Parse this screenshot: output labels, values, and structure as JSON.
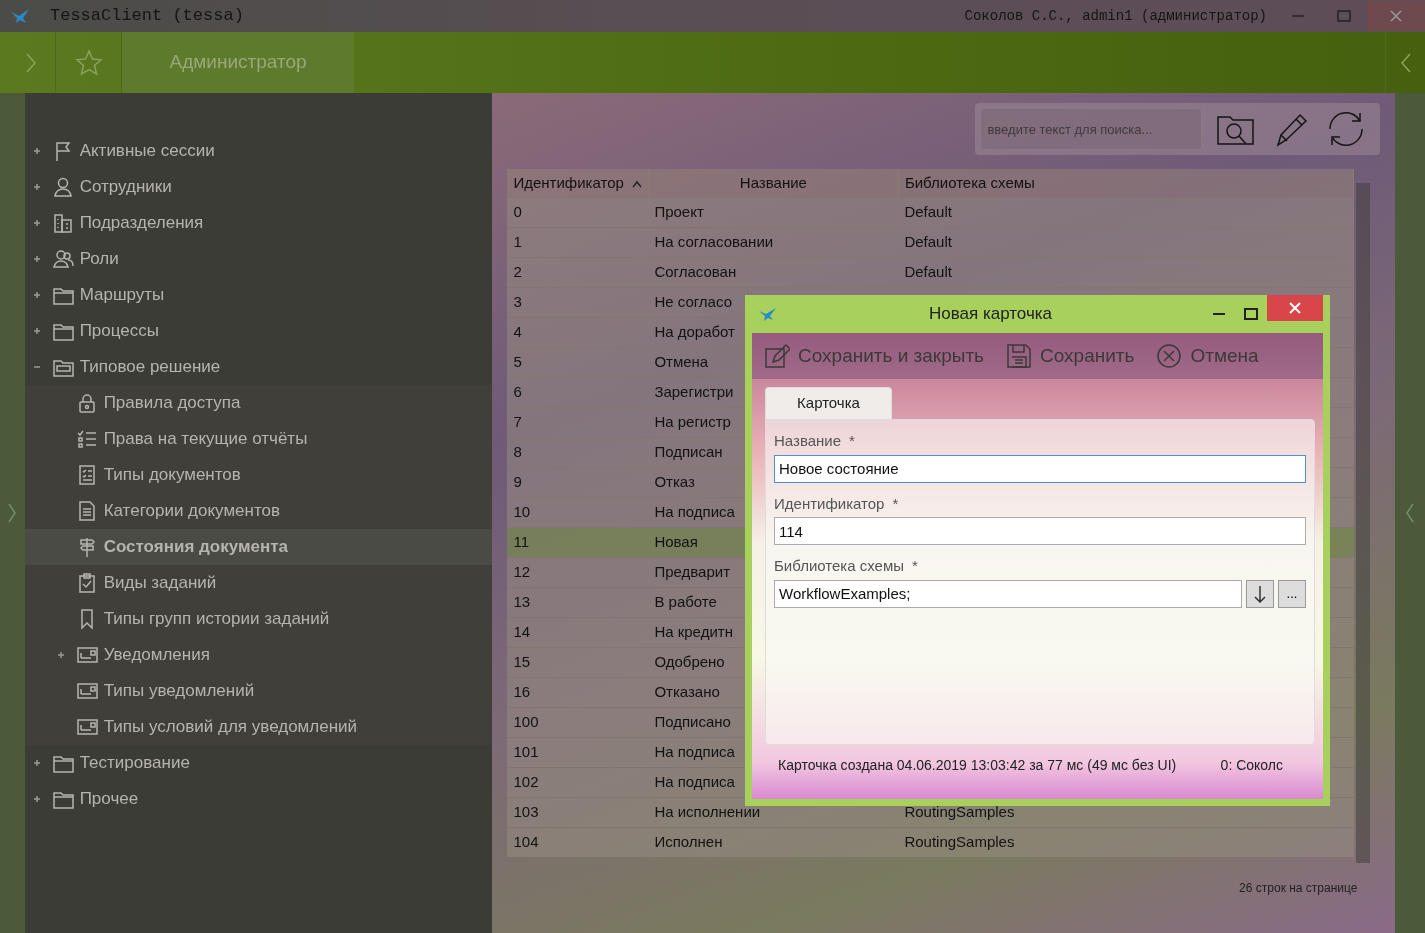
{
  "window": {
    "title": "TessaClient (tessa)",
    "user": "Соколов С.С., admin1 (администратор)"
  },
  "toolbar": {
    "tabs": [
      {
        "label": "Администратор",
        "selected": true
      }
    ]
  },
  "sidebar": {
    "items": [
      {
        "label": "Активные сессии",
        "expanded": false,
        "selected": false
      },
      {
        "label": "Сотрудники",
        "expanded": false,
        "selected": false
      },
      {
        "label": "Подразделения",
        "expanded": false,
        "selected": false
      },
      {
        "label": "Роли",
        "expanded": false,
        "selected": false
      },
      {
        "label": "Маршруты",
        "expanded": false,
        "selected": false
      },
      {
        "label": "Процессы",
        "expanded": false,
        "selected": false
      },
      {
        "label": "Типовое решение",
        "expanded": true,
        "selected": false,
        "children": [
          {
            "label": "Правила доступа",
            "selected": false
          },
          {
            "label": "Права на текущие отчёты",
            "selected": false
          },
          {
            "label": "Типы документов",
            "selected": false
          },
          {
            "label": "Категории документов",
            "selected": false
          },
          {
            "label": "Состояния документа",
            "selected": true
          },
          {
            "label": "Виды заданий",
            "selected": false
          },
          {
            "label": "Типы групп истории заданий",
            "selected": false
          },
          {
            "label": "Уведомления",
            "expanded": false,
            "selected": false
          },
          {
            "label": "Типы уведомлений",
            "selected": false
          },
          {
            "label": "Типы условий для уведомлений",
            "selected": false
          }
        ]
      },
      {
        "label": "Тестирование",
        "expanded": false,
        "selected": false
      },
      {
        "label": "Прочее",
        "expanded": false,
        "selected": false
      }
    ]
  },
  "search": {
    "placeholder": "введите текст для поиска..."
  },
  "table": {
    "columns": [
      {
        "label": "Идентификатор",
        "sorted": true
      },
      {
        "label": "Название",
        "sorted": false
      },
      {
        "label": "Библиотека схемы",
        "sorted": false
      }
    ],
    "rows": [
      {
        "id": "0",
        "name": "Проект",
        "library": "Default",
        "selected": false
      },
      {
        "id": "1",
        "name": "На согласовании",
        "library": "Default",
        "selected": false
      },
      {
        "id": "2",
        "name": "Согласован",
        "library": "Default",
        "selected": false
      },
      {
        "id": "3",
        "name": "Не согласо",
        "selected": false
      },
      {
        "id": "4",
        "name": "На доработ",
        "selected": false
      },
      {
        "id": "5",
        "name": "Отмена",
        "selected": false
      },
      {
        "id": "6",
        "name": "Зарегистри",
        "selected": false
      },
      {
        "id": "7",
        "name": "На регистр",
        "selected": false
      },
      {
        "id": "8",
        "name": "Подписан",
        "selected": false
      },
      {
        "id": "9",
        "name": "Отказ",
        "selected": false
      },
      {
        "id": "10",
        "name": "На подписа",
        "selected": false
      },
      {
        "id": "11",
        "name": "Новая",
        "selected": true
      },
      {
        "id": "12",
        "name": "Предварит",
        "selected": false
      },
      {
        "id": "13",
        "name": "В работе",
        "selected": false
      },
      {
        "id": "14",
        "name": "На кредитн",
        "selected": false
      },
      {
        "id": "15",
        "name": "Одобрено",
        "selected": false
      },
      {
        "id": "16",
        "name": "Отказано",
        "selected": false
      },
      {
        "id": "100",
        "name": "Подписано",
        "selected": false
      },
      {
        "id": "101",
        "name": "На подписа",
        "selected": false
      },
      {
        "id": "102",
        "name": "На подписа",
        "selected": false
      },
      {
        "id": "103",
        "name": "На исполнении",
        "library": "RoutingSamples",
        "selected": false
      },
      {
        "id": "104",
        "name": "Исполнен",
        "library": "RoutingSamples",
        "selected": false
      }
    ],
    "footer": "26 строк на странице"
  },
  "dialog": {
    "title": "Новая карточка",
    "actions": [
      {
        "label": "Сохранить и закрыть"
      },
      {
        "label": "Сохранить"
      },
      {
        "label": "Отмена"
      }
    ],
    "tabs": [
      {
        "label": "Карточка",
        "selected": true
      }
    ],
    "fields": [
      {
        "label": "Название",
        "required_mark": "*",
        "value": "Новое состояние",
        "focused": true
      },
      {
        "label": "Идентификатор",
        "required_mark": "*",
        "value": "114",
        "focused": false
      },
      {
        "label": "Библиотека схемы",
        "required_mark": "*",
        "value": "WorkflowExamples;",
        "focused": false,
        "more_button": "..."
      }
    ],
    "status": "Карточка создана 04.06.2019 13:03:42 за 77 мс (49 мс без UI)",
    "status_right": "0:  Соколс"
  }
}
